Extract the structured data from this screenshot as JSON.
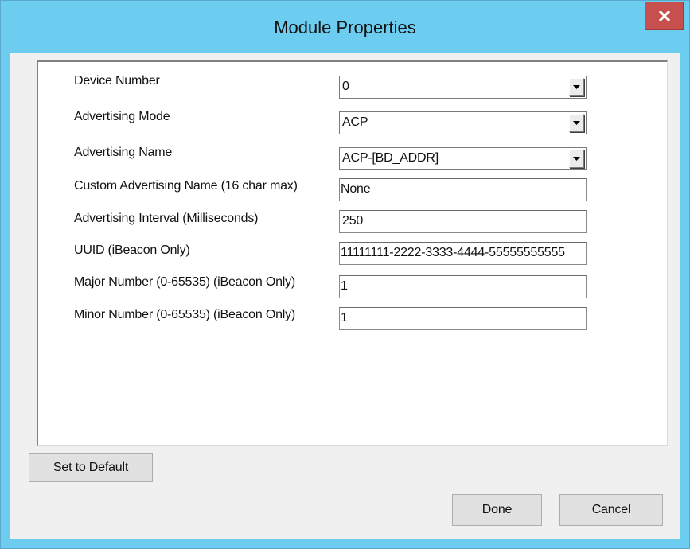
{
  "window": {
    "title": "Module Properties",
    "close_glyph": "x"
  },
  "form": {
    "device_number": {
      "label": "Device Number",
      "value": "0"
    },
    "advertising_mode": {
      "label": "Advertising Mode",
      "value": "ACP"
    },
    "advertising_name": {
      "label": "Advertising Name",
      "value": "ACP-[BD_ADDR]"
    },
    "custom_advertising_name": {
      "label": "Custom Advertising Name (16 char max)",
      "value": "None"
    },
    "advertising_interval": {
      "label": "Advertising Interval (Milliseconds)",
      "value": "250"
    },
    "uuid": {
      "label": "UUID (iBeacon Only)",
      "value": "11111111-2222-3333-4444-55555555555"
    },
    "major_number": {
      "label": "Major Number (0-65535) (iBeacon Only)",
      "value": "1"
    },
    "minor_number": {
      "label": "Minor Number (0-65535) (iBeacon Only)",
      "value": "1"
    }
  },
  "buttons": {
    "set_default": "Set to Default",
    "done": "Done",
    "cancel": "Cancel"
  },
  "icons": {
    "close": "close-icon",
    "dropdown": "chevron-down-icon"
  },
  "colors": {
    "titlebar": "#6ccdf0",
    "close_button": "#c7504f",
    "client_background": "#f0f0f0",
    "panel_background": "#ffffff"
  }
}
